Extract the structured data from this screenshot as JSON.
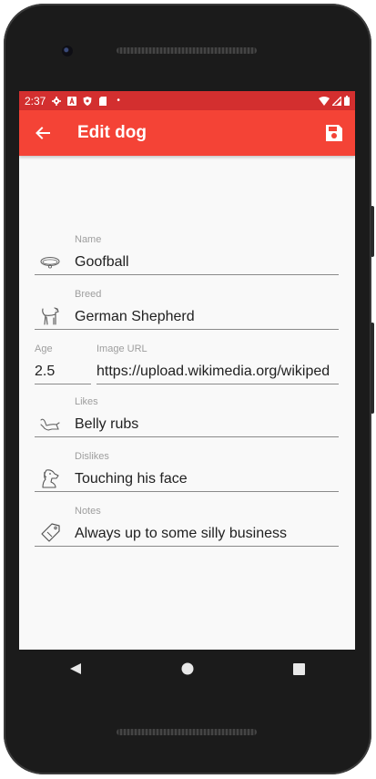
{
  "status_bar": {
    "time": "2:37",
    "dot": "•",
    "left_icons": [
      "settings-icon",
      "a-icon",
      "shield-icon",
      "sd-card-icon"
    ],
    "right_icons": [
      "wifi-icon",
      "signal-icon",
      "battery-icon"
    ]
  },
  "app_bar": {
    "title": "Edit dog",
    "back_icon": "arrow-left-icon",
    "save_icon": "save-icon",
    "color": "#f44336",
    "status_color": "#d32f2f"
  },
  "form": {
    "name": {
      "label": "Name",
      "value": "Goofball",
      "icon": "collar-icon"
    },
    "breed": {
      "label": "Breed",
      "value": "German Shepherd",
      "icon": "dog-icon"
    },
    "age": {
      "label": "Age",
      "value": "2.5"
    },
    "image_url": {
      "label": "Image URL",
      "value": "https://upload.wikimedia.org/wikiped"
    },
    "likes": {
      "label": "Likes",
      "value": "Belly rubs",
      "icon": "dog-lying-icon"
    },
    "dislikes": {
      "label": "Dislikes",
      "value": "Touching his face",
      "icon": "dog-face-icon"
    },
    "notes": {
      "label": "Notes",
      "value": "Always up to some silly business",
      "icon": "tag-icon"
    }
  },
  "nav_bar": {
    "back": "triangle-back-icon",
    "home": "circle-home-icon",
    "recents": "square-recents-icon"
  }
}
